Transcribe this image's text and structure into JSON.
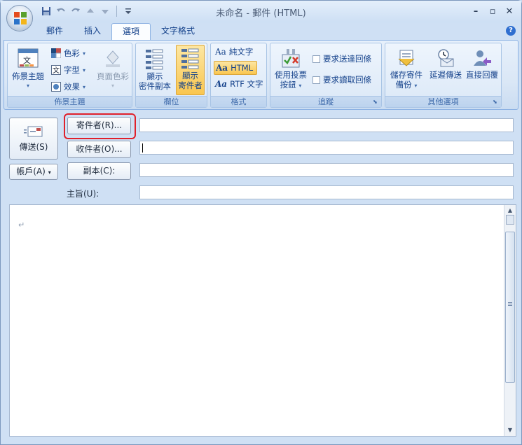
{
  "window": {
    "title": "未命名 - 郵件 (HTML)",
    "controls": {
      "minimize": "–",
      "maximize": "▫",
      "close": "✕"
    }
  },
  "tabs": [
    "郵件",
    "插入",
    "選項",
    "文字格式"
  ],
  "active_tab": "選項",
  "help": "?",
  "ribbon": {
    "theme_group": {
      "label": "佈景主題",
      "theme_button": "佈景主題",
      "colors": "色彩",
      "fonts": "字型",
      "effects": "效果",
      "page_color": "頁面色彩"
    },
    "fields_group": {
      "label": "欄位",
      "show_bcc": "顯示\n密件副本",
      "show_bcc_line1": "顯示",
      "show_bcc_line2": "密件副本",
      "show_from_line1": "顯示",
      "show_from_line2": "寄件者"
    },
    "format_group": {
      "label": "格式",
      "plain_text": "純文字",
      "html": "HTML",
      "rtf": "RTF 文字"
    },
    "tracking_group": {
      "label": "追蹤",
      "voting_line1": "使用投票",
      "voting_line2": "按鈕",
      "delivery_receipt": "要求送達回條",
      "read_receipt": "要求讀取回條"
    },
    "more_group": {
      "label": "其他選項",
      "save_sent_line1": "儲存寄件",
      "save_sent_line2": "備份",
      "delay_delivery": "延遲傳送",
      "direct_replies": "直接回覆"
    }
  },
  "compose": {
    "send": "傳送(S)",
    "account": "帳戶(A)",
    "from": "寄件者(R)...",
    "to": "收件者(O)...",
    "cc": "副本(C):",
    "subject_label": "主旨(U):",
    "from_value": "",
    "to_value": "",
    "cc_value": "",
    "subject_value": "",
    "body_mark": "↵"
  }
}
